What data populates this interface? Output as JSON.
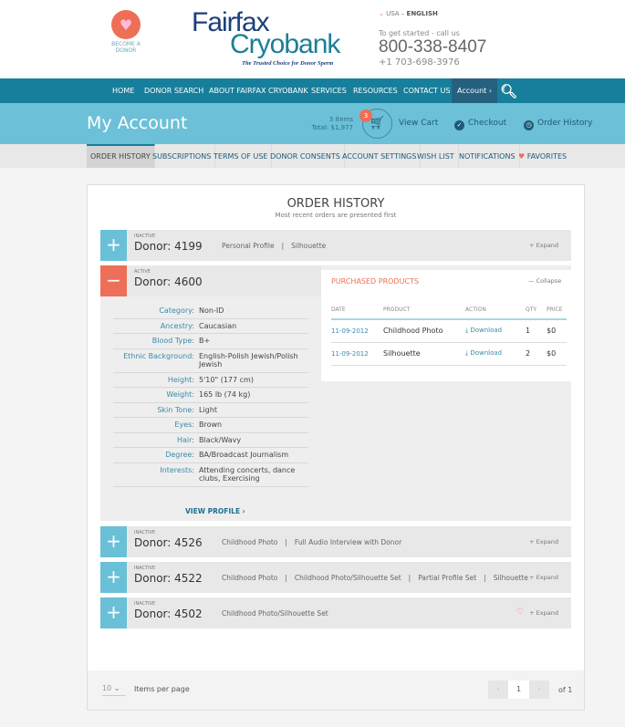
{
  "header": {
    "become_donor": "BECOME A DONOR",
    "logo_line1": "Fairfax",
    "logo_line2": "Cryobank",
    "tagline": "The Trusted Choice for Donor Sperm",
    "country": "USA",
    "language": "ENGLISH",
    "call_text": "To get started - call us",
    "phone": "800-338-8407",
    "phone_intl": "+1 703-698-3976"
  },
  "nav": {
    "items": [
      "HOME",
      "DONOR SEARCH",
      "ABOUT FAIRFAX CRYOBANK",
      "SERVICES",
      "RESOURCES",
      "CONTACT US"
    ],
    "account": "Account ›"
  },
  "account_bar": {
    "title": "My Account",
    "items_count": "3 Items",
    "total": "Total: $1,977",
    "cart_badge": "3",
    "view_cart": "View Cart",
    "checkout": "Checkout",
    "order_history": "Order History"
  },
  "tabs": [
    "ORDER HISTORY",
    "SUBSCRIPTIONS",
    "TERMS OF USE",
    "DONOR CONSENTS",
    "ACCOUNT SETTINGS",
    "WISH LIST",
    "NOTIFICATIONS",
    "FAVORITES"
  ],
  "main": {
    "title": "ORDER HISTORY",
    "subtitle": "Most recent orders are presented first",
    "orders": [
      {
        "status": "INACTIVE",
        "donor": "Donor: 4199",
        "products": [
          "Personal Profile",
          "Silhouette"
        ],
        "action": "+ Expand"
      },
      {
        "status": "ACTIVE",
        "donor": "Donor: 4600",
        "action": "— Collapse"
      },
      {
        "status": "INACTIVE",
        "donor": "Donor: 4526",
        "products": [
          "Childhood Photo",
          "Full Audio Interview with Donor"
        ],
        "action": "+ Expand"
      },
      {
        "status": "INACTIVE",
        "donor": "Donor: 4522",
        "products": [
          "Childhood Photo",
          "Childhood Photo/Silhouette Set",
          "Partial Profile Set",
          "Silhouette"
        ],
        "action": "+ Expand"
      },
      {
        "status": "INACTIVE",
        "donor": "Donor: 4502",
        "products": [
          "Childhood Photo/Silhouette Set"
        ],
        "action": "+ Expand"
      }
    ],
    "details": [
      {
        "label": "Category:",
        "value": "Non-ID"
      },
      {
        "label": "Ancestry:",
        "value": "Caucasian"
      },
      {
        "label": "Blood Type:",
        "value": "B+"
      },
      {
        "label": "Ethnic Background:",
        "value": "English-Polish Jewish/Polish Jewish"
      },
      {
        "label": "Height:",
        "value": "5'10\" (177 cm)"
      },
      {
        "label": "Weight:",
        "value": "165 lb (74 kg)"
      },
      {
        "label": "Skin Tone:",
        "value": "Light"
      },
      {
        "label": "Eyes:",
        "value": "Brown"
      },
      {
        "label": "Hair:",
        "value": "Black/Wavy"
      },
      {
        "label": "Degree:",
        "value": "BA/Broadcast Journalism"
      },
      {
        "label": "Interests:",
        "value": "Attending concerts, dance clubs, Exercising"
      }
    ],
    "view_profile": "VIEW PROFILE ›",
    "purchased": {
      "tab": "PURCHASED PRODUCTS",
      "headers": [
        "DATE",
        "PRODUCT",
        "ACTION",
        "QTY",
        "PRICE"
      ],
      "rows": [
        {
          "date": "11-09-2012",
          "product": "Childhood Photo",
          "action": "Download",
          "qty": "1",
          "price": "$0"
        },
        {
          "date": "11-09-2012",
          "product": "Silhouette",
          "action": "Download",
          "qty": "2",
          "price": "$0"
        }
      ]
    }
  },
  "footer": {
    "per_page": "10",
    "per_page_label": "Items per page",
    "page": "1",
    "of": "of 1"
  },
  "colors": {
    "teal": "#177f9c",
    "light_blue": "#6cc0d7",
    "coral": "#ee6f57"
  }
}
